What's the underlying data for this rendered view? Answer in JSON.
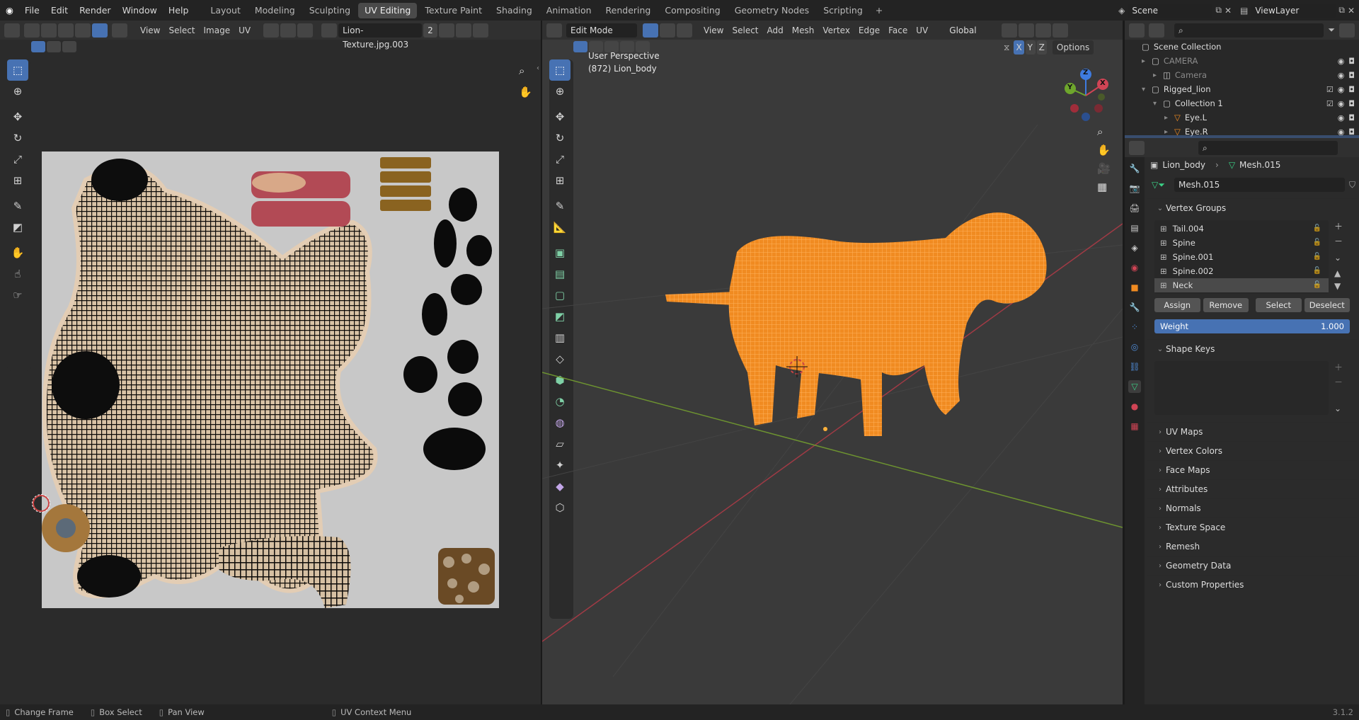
{
  "menu": [
    "File",
    "Edit",
    "Render",
    "Window",
    "Help"
  ],
  "workspaces": [
    {
      "label": "Layout",
      "active": false
    },
    {
      "label": "Modeling",
      "active": false
    },
    {
      "label": "Sculpting",
      "active": false
    },
    {
      "label": "UV Editing",
      "active": true
    },
    {
      "label": "Texture Paint",
      "active": false
    },
    {
      "label": "Shading",
      "active": false
    },
    {
      "label": "Animation",
      "active": false
    },
    {
      "label": "Rendering",
      "active": false
    },
    {
      "label": "Compositing",
      "active": false
    },
    {
      "label": "Geometry Nodes",
      "active": false
    },
    {
      "label": "Scripting",
      "active": false
    }
  ],
  "add_workspace": "+",
  "scene_name": "Scene",
  "view_layer": "ViewLayer",
  "uv_editor": {
    "menus": [
      "View",
      "Select",
      "Image",
      "UV"
    ],
    "image_name": "Lion-Texture.jpg.003",
    "image_users": "2"
  },
  "viewport": {
    "mode": "Edit Mode",
    "menus": [
      "View",
      "Select",
      "Add",
      "Mesh",
      "Vertex",
      "Edge",
      "Face",
      "UV"
    ],
    "orientation": "Global",
    "options_label": "Options",
    "axes": [
      "X",
      "Y",
      "Z"
    ],
    "overlay_title": "User Perspective",
    "overlay_object": "(872) Lion_body",
    "gizmo": {
      "x": "X",
      "y": "Y",
      "z": "Z"
    }
  },
  "outliner": {
    "root": "Scene Collection",
    "items": [
      {
        "label": "CAMERA",
        "depth": 1,
        "dim": true
      },
      {
        "label": "Camera",
        "depth": 2,
        "dim": true
      },
      {
        "label": "Rigged_lion",
        "depth": 1,
        "dim": false
      },
      {
        "label": "Collection 1",
        "depth": 2,
        "dim": false
      },
      {
        "label": "Eye.L",
        "depth": 3,
        "dim": false
      },
      {
        "label": "Eye.R",
        "depth": 3,
        "dim": false
      }
    ]
  },
  "properties": {
    "breadcrumb_object": "Lion_body",
    "breadcrumb_mesh": "Mesh.015",
    "mesh_name": "Mesh.015",
    "vertex_groups_title": "Vertex Groups",
    "vertex_groups": [
      "Tail.004",
      "Spine",
      "Spine.001",
      "Spine.002",
      "Neck"
    ],
    "active_group": "Neck",
    "buttons": {
      "assign": "Assign",
      "remove": "Remove",
      "select": "Select",
      "deselect": "Deselect"
    },
    "weight_label": "Weight",
    "weight_value": "1.000",
    "shape_keys_title": "Shape Keys",
    "panels": [
      "UV Maps",
      "Vertex Colors",
      "Face Maps",
      "Attributes",
      "Normals",
      "Texture Space",
      "Remesh",
      "Geometry Data",
      "Custom Properties"
    ]
  },
  "status": {
    "items": [
      "Change Frame",
      "Box Select",
      "Pan View",
      "UV Context Menu"
    ],
    "version": "3.1.2"
  },
  "colors": {
    "accent": "#4772b3",
    "mesh": "#ff8a1a",
    "header": "#303030"
  }
}
